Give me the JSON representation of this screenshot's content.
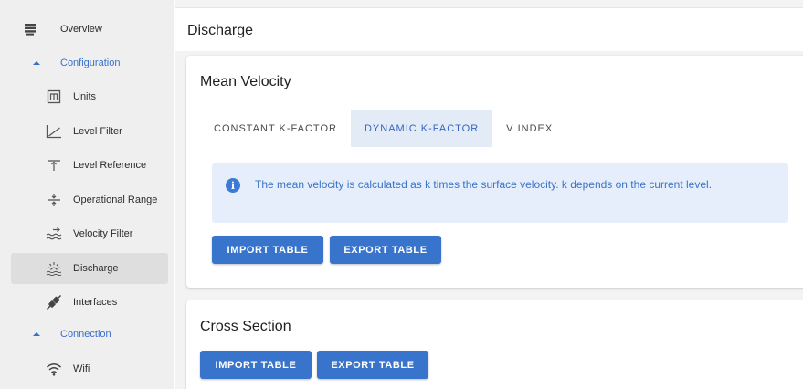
{
  "sidebar": {
    "items": [
      {
        "label": "Overview",
        "icon": "dashboard-icon"
      },
      {
        "label": "Configuration",
        "icon": "chevron-up-icon"
      },
      {
        "label": "Units",
        "icon": "units-icon"
      },
      {
        "label": "Level Filter",
        "icon": "level-filter-icon"
      },
      {
        "label": "Level Reference",
        "icon": "level-reference-icon"
      },
      {
        "label": "Operational Range",
        "icon": "operational-range-icon"
      },
      {
        "label": "Velocity Filter",
        "icon": "velocity-filter-icon"
      },
      {
        "label": "Discharge",
        "icon": "discharge-icon"
      },
      {
        "label": "Interfaces",
        "icon": "interfaces-icon"
      },
      {
        "label": "Connection",
        "icon": "chevron-up-icon"
      },
      {
        "label": "Wifi",
        "icon": "wifi-icon"
      }
    ],
    "active": "Discharge"
  },
  "page": {
    "title": "Discharge"
  },
  "mean_velocity": {
    "title": "Mean Velocity",
    "tabs": [
      "CONSTANT K-FACTOR",
      "DYNAMIC K-FACTOR",
      "V INDEX"
    ],
    "active_tab": "DYNAMIC K-FACTOR",
    "info": "The mean velocity is calculated as k times the surface velocity. k depends on the current level.",
    "import_label": "IMPORT TABLE",
    "export_label": "EXPORT TABLE"
  },
  "cross_section": {
    "title": "Cross Section",
    "import_label": "IMPORT TABLE",
    "export_label": "EXPORT TABLE"
  },
  "colors": {
    "accent": "#3874cb",
    "info_bg": "#e5eefa",
    "tab_active_bg": "#e3ebf7"
  }
}
